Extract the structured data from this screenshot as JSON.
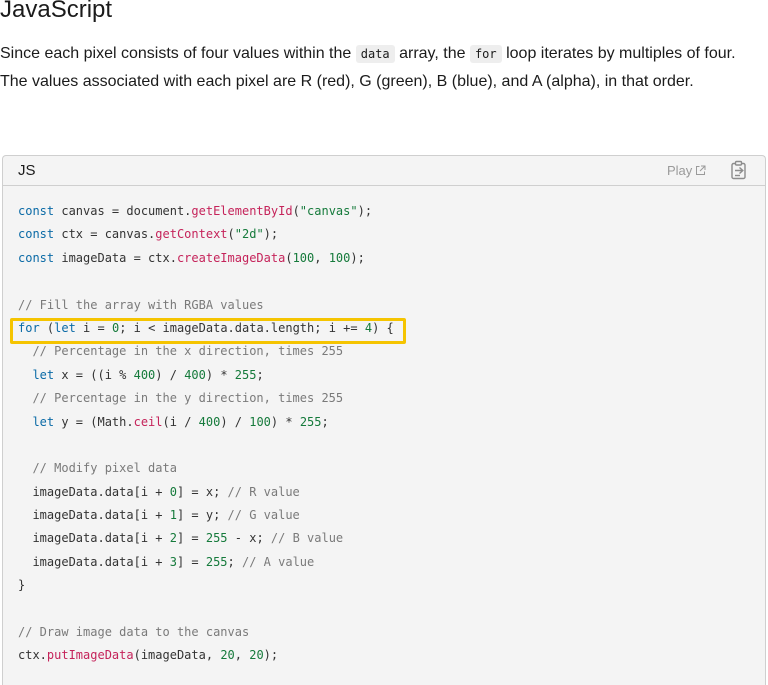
{
  "heading": "JavaScript",
  "paragraph": {
    "p1": "Since each pixel consists of four values within the ",
    "code1": "data",
    "p2": " array, the ",
    "code2": "for",
    "p3": " loop iterates by multiples of four. The values associated with each pixel are R (red), G (green), B (blue), and A (alpha), in that order."
  },
  "code_box": {
    "language": "JS",
    "play_label": "Play",
    "play_icon": "external-link-icon",
    "copy_icon": "clipboard-copy-icon",
    "lines": [
      [
        [
          "kw",
          "const"
        ],
        [
          "",
          "canvas = document."
        ],
        [
          "fn",
          "getElementById"
        ],
        [
          "",
          "("
        ],
        [
          "str",
          "\"canvas\""
        ],
        [
          "",
          ");"
        ]
      ],
      [
        [
          "kw",
          "const"
        ],
        [
          "",
          "ctx = canvas."
        ],
        [
          "fn",
          "getContext"
        ],
        [
          "",
          "("
        ],
        [
          "str",
          "\"2d\""
        ],
        [
          "",
          ");"
        ]
      ],
      [
        [
          "kw",
          "const"
        ],
        [
          "",
          "imageData = ctx."
        ],
        [
          "fn",
          "createImageData"
        ],
        [
          "",
          "("
        ],
        [
          "num",
          "100"
        ],
        [
          "",
          ", "
        ],
        [
          "num",
          "100"
        ],
        [
          "",
          ");"
        ]
      ],
      [],
      [
        [
          "cm",
          "// Fill the array with RGBA values"
        ]
      ],
      [
        [
          "kw",
          "for"
        ],
        [
          "",
          ""
        ],
        [
          "",
          "("
        ],
        [
          "kw",
          "let"
        ],
        [
          "",
          "i = "
        ],
        [
          "num",
          "0"
        ],
        [
          "",
          "; i < imageData.data.length; i += "
        ],
        [
          "num",
          "4"
        ],
        [
          "",
          ") {"
        ]
      ],
      [
        [
          "",
          "  "
        ],
        [
          "cm",
          "// Percentage in the x direction, times 255"
        ]
      ],
      [
        [
          "",
          "  "
        ],
        [
          "kw",
          "let"
        ],
        [
          "",
          "x = ((i % "
        ],
        [
          "num",
          "400"
        ],
        [
          "",
          ") / "
        ],
        [
          "num",
          "400"
        ],
        [
          "",
          ") * "
        ],
        [
          "num",
          "255"
        ],
        [
          "",
          ";"
        ]
      ],
      [
        [
          "",
          "  "
        ],
        [
          "cm",
          "// Percentage in the y direction, times 255"
        ]
      ],
      [
        [
          "",
          "  "
        ],
        [
          "kw",
          "let"
        ],
        [
          "",
          "y = (Math."
        ],
        [
          "fn",
          "ceil"
        ],
        [
          "",
          "(i / "
        ],
        [
          "num",
          "400"
        ],
        [
          "",
          ") / "
        ],
        [
          "num",
          "100"
        ],
        [
          "",
          ") * "
        ],
        [
          "num",
          "255"
        ],
        [
          "",
          ";"
        ]
      ],
      [],
      [
        [
          "",
          "  "
        ],
        [
          "cm",
          "// Modify pixel data"
        ]
      ],
      [
        [
          "",
          "  imageData.data[i + "
        ],
        [
          "num",
          "0"
        ],
        [
          "",
          "] = x; "
        ],
        [
          "cm",
          "// R value"
        ]
      ],
      [
        [
          "",
          "  imageData.data[i + "
        ],
        [
          "num",
          "1"
        ],
        [
          "",
          "] = y; "
        ],
        [
          "cm",
          "// G value"
        ]
      ],
      [
        [
          "",
          "  imageData.data[i + "
        ],
        [
          "num",
          "2"
        ],
        [
          "",
          "] = "
        ],
        [
          "num",
          "255"
        ],
        [
          "",
          " - x; "
        ],
        [
          "cm",
          "// B value"
        ]
      ],
      [
        [
          "",
          "  imageData.data[i + "
        ],
        [
          "num",
          "3"
        ],
        [
          "",
          "] = "
        ],
        [
          "num",
          "255"
        ],
        [
          "",
          "; "
        ],
        [
          "cm",
          "// A value"
        ]
      ],
      [
        [
          "",
          "}"
        ]
      ],
      [],
      [
        [
          "cm",
          "// Draw image data to the canvas"
        ]
      ],
      [
        [
          "",
          "ctx."
        ],
        [
          "fn",
          "putImageData"
        ],
        [
          "",
          "(imageData, "
        ],
        [
          "num",
          "20"
        ],
        [
          "",
          ", "
        ],
        [
          "num",
          "20"
        ],
        [
          "",
          ");"
        ]
      ]
    ]
  }
}
